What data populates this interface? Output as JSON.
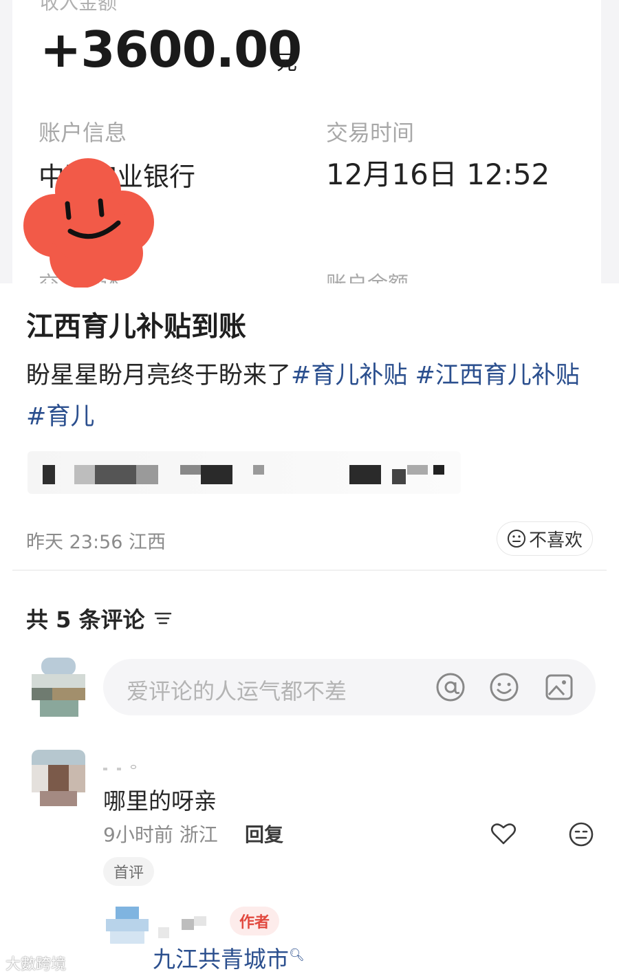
{
  "receipt": {
    "label_top": "收入金额",
    "amount": "+3600.00",
    "unit": "元",
    "account_label": "账户信息",
    "account_value": "中国农业银行",
    "time_label": "交易时间",
    "time_value": "12月16日 12:52",
    "desc_label": "交易描述",
    "balance_label": "账户余额"
  },
  "post": {
    "title": "江西育儿补贴到账",
    "body_text": "盼星星盼月亮终于盼来了",
    "hashtags": [
      "#育儿补贴",
      "#江西育儿补贴",
      "#育儿"
    ],
    "meta": "昨天 23:56 江西",
    "dislike_label": "不喜欢"
  },
  "comments": {
    "header": "共 5 条评论",
    "input_placeholder": "爱评论的人运气都不差",
    "items": [
      {
        "text": "哪里的呀亲",
        "meta": "9小时前 浙江",
        "reply_label": "回复",
        "badge": "首评"
      }
    ],
    "reply": {
      "badge": "作者",
      "text": "九江共青城市"
    }
  },
  "watermark": "大數跨境",
  "colors": {
    "hashtag": "#2b4f8e",
    "author_badge": "#e1493f",
    "sticker": "#f25a48"
  }
}
